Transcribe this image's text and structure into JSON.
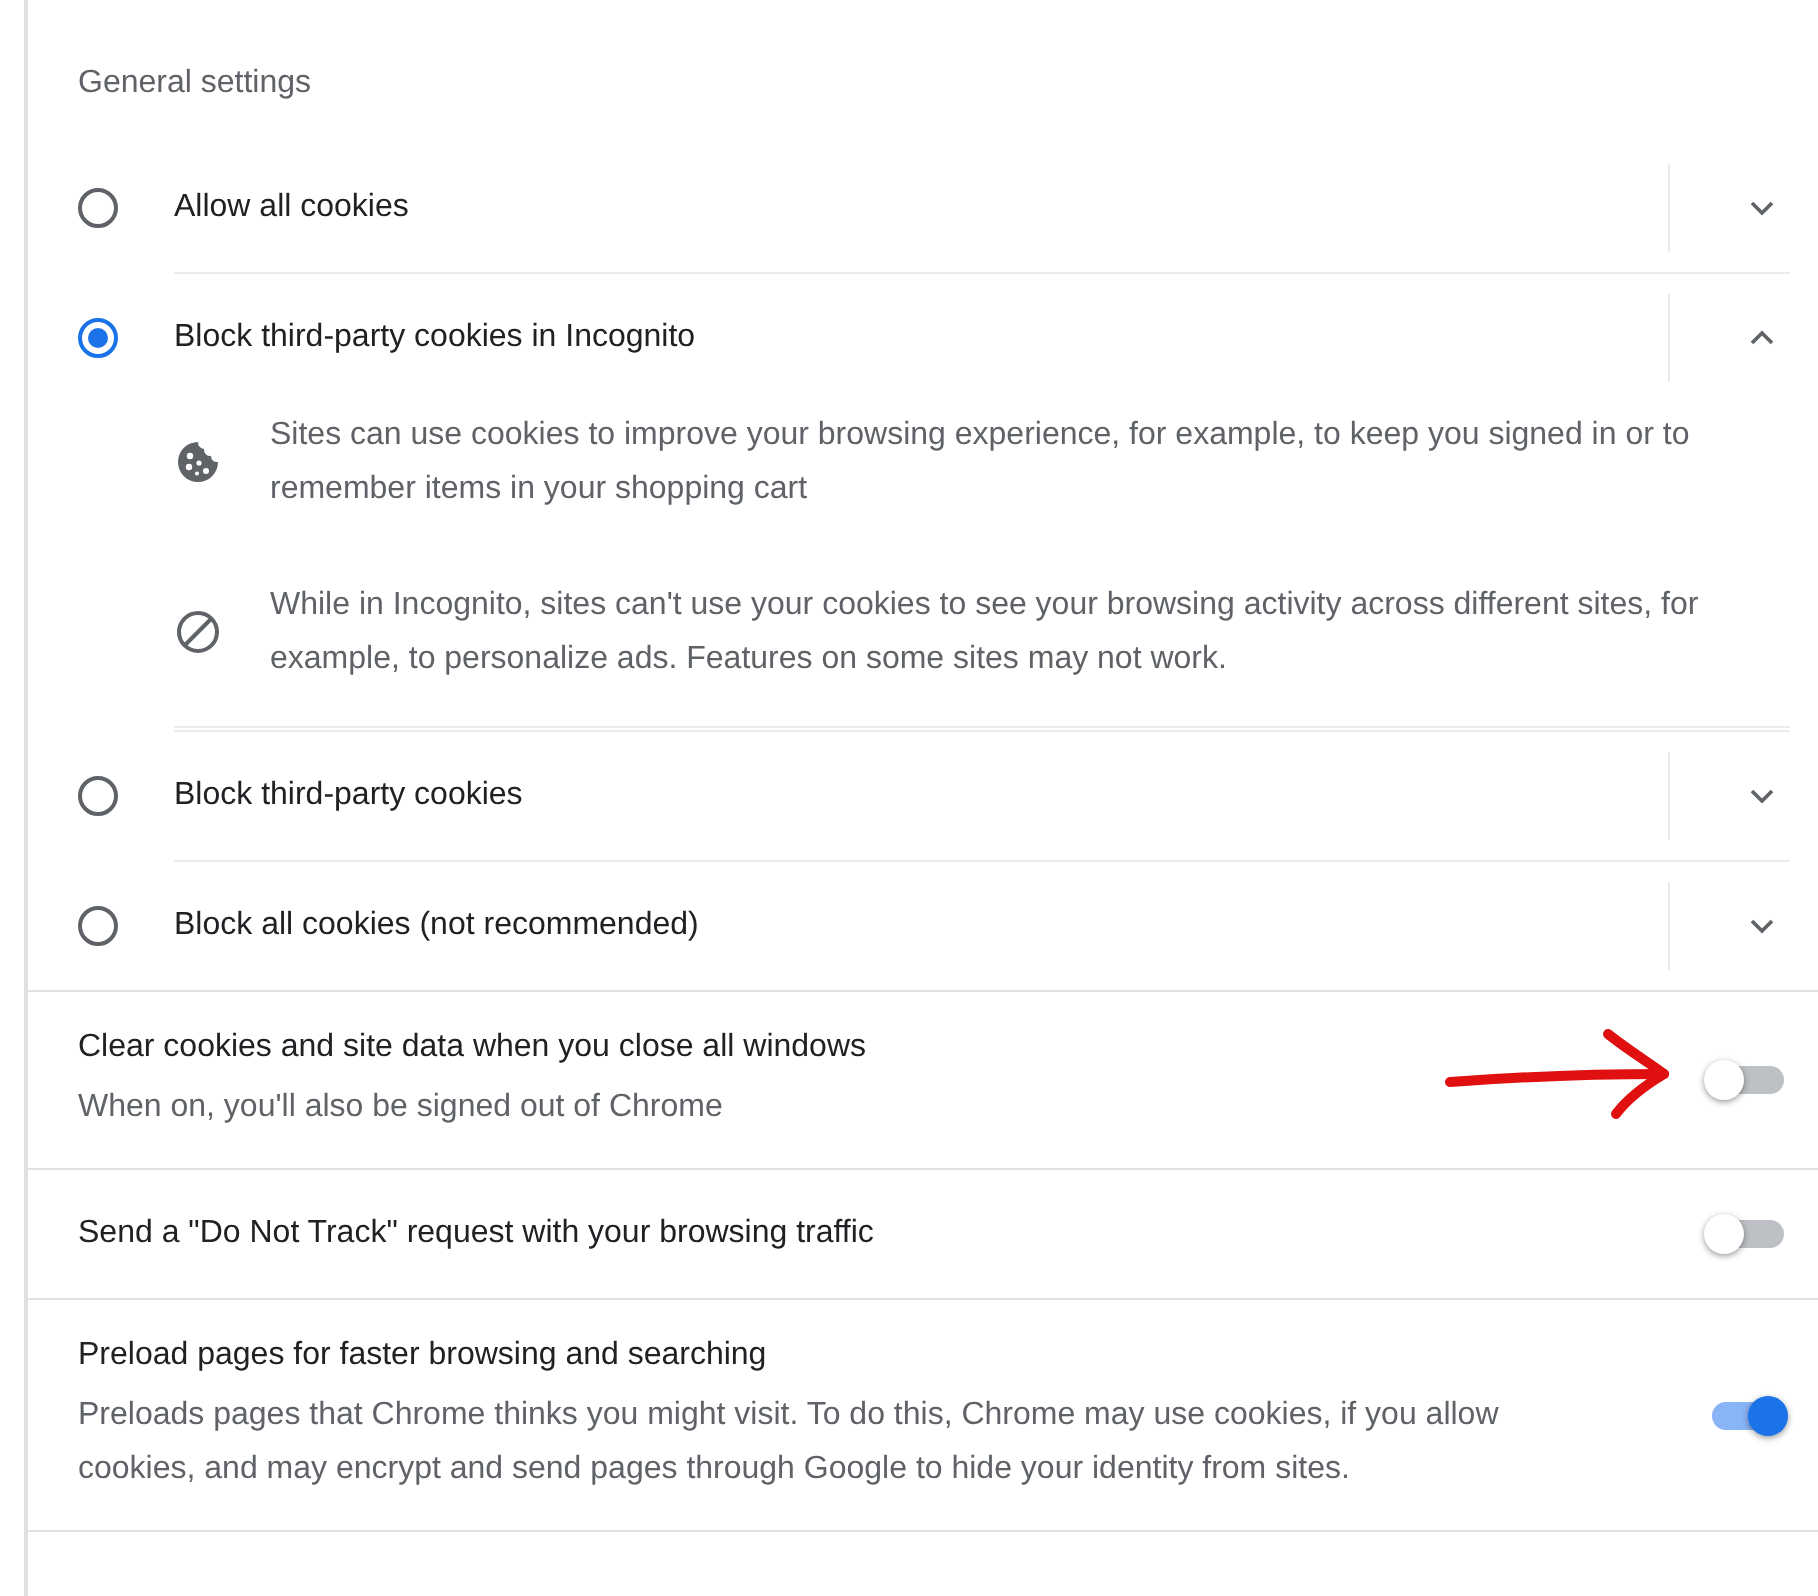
{
  "section_title": "General settings",
  "cookie_options": [
    {
      "label": "Allow all cookies",
      "selected": false,
      "expanded": false
    },
    {
      "label": "Block third-party cookies in Incognito",
      "selected": true,
      "expanded": true,
      "details": [
        {
          "kind": "cookie",
          "text": "Sites can use cookies to improve your browsing experience, for example, to keep you signed in or to remember items in your shopping cart"
        },
        {
          "kind": "blocked",
          "text": "While in Incognito, sites can't use your cookies to see your browsing activity across different sites, for example, to personalize ads. Features on some sites may not work."
        }
      ]
    },
    {
      "label": "Block third-party cookies",
      "selected": false,
      "expanded": false
    },
    {
      "label": "Block all cookies (not recommended)",
      "selected": false,
      "expanded": false
    }
  ],
  "toggles": [
    {
      "label": "Clear cookies and site data when you close all windows",
      "sublabel": "When on, you'll also be signed out of Chrome",
      "on": false,
      "annotated": true
    },
    {
      "label": "Send a \"Do Not Track\" request with your browsing traffic",
      "on": false,
      "annotated": false
    },
    {
      "label": "Preload pages for faster browsing and searching",
      "sublabel": "Preloads pages that Chrome thinks you might visit. To do this, Chrome may use cookies, if you allow cookies, and may encrypt and send pages through Google to hide your identity from sites.",
      "on": true,
      "annotated": false
    }
  ]
}
